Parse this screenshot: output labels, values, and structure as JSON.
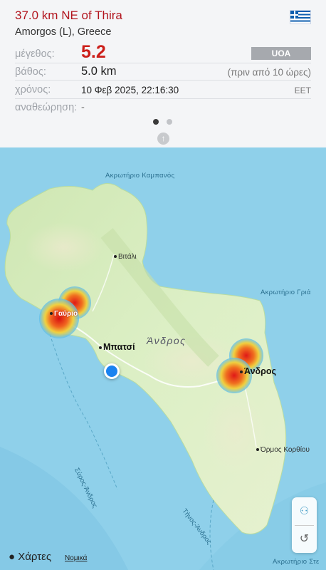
{
  "header": {
    "title": "37.0 km NE of Thira",
    "subtitle": "Amorgos (L), Greece"
  },
  "details": {
    "magnitude_label": "μέγεθος:",
    "magnitude_value": "5.2",
    "agency": "UOA",
    "depth_label": "βάθος:",
    "depth_value": "5.0 km",
    "depth_ago": "(πριν από 10 ώρες)",
    "time_label": "χρόνος:",
    "time_value": "10 Φεβ 2025, 22:16:30",
    "timezone": "EET",
    "review_label": "αναθεώρηση:",
    "review_value": "-"
  },
  "pager": {
    "count": 2,
    "active": 0
  },
  "map": {
    "places": {
      "cape_kampanos": "Ακρωτήριο Καμπανός",
      "vitali": "Βιτάλι",
      "cape_gria": "Ακρωτήριο Γριά",
      "gavrio": "Γαύριο",
      "batsi": "Μπατσί",
      "andros_island": "Άνδρος",
      "andros_town": "Άνδρος",
      "syros_andros": "Σύρος-Άνδρος",
      "ormos_korthiou": "Όρμος Κορθίου",
      "tinos_andros": "Τήνος-Άνδρος",
      "cape_ste": "Ακρωτήριο Στε"
    },
    "footer": {
      "maps_brand": "Χάρτες",
      "legal": "Νομικά"
    },
    "controls": {
      "first_icon": "people-icon",
      "second_icon": "history-icon"
    }
  },
  "colors": {
    "title_red": "#b2141d",
    "magnitude_red": "#cc1f1a",
    "sea": "#8fd0ea",
    "land": "#d9ecc0",
    "location_blue": "#1a82f0"
  }
}
